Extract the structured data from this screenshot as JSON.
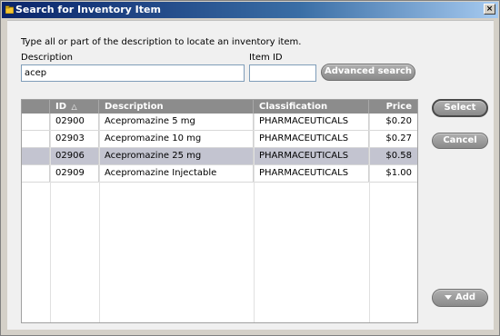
{
  "window": {
    "title": "Search for Inventory Item",
    "close_glyph": "×",
    "app_icon": "folder-icon"
  },
  "form": {
    "instructions": "Type all or part of the description to locate an inventory item.",
    "description_label": "Description",
    "description_value": "acep",
    "item_id_label": "Item ID",
    "item_id_value": "",
    "advanced_search_label": "Advanced search"
  },
  "table": {
    "columns": [
      {
        "label": ""
      },
      {
        "label": "ID",
        "sort": "ascending",
        "sort_glyph": "△"
      },
      {
        "label": "Description"
      },
      {
        "label": "Classification"
      },
      {
        "label": "Price"
      }
    ],
    "rows": [
      {
        "id": "02900",
        "description": "Acepromazine  5 mg",
        "classification": "PHARMACEUTICALS",
        "price": "$0.20",
        "selected": false
      },
      {
        "id": "02903",
        "description": "Acepromazine 10 mg",
        "classification": "PHARMACEUTICALS",
        "price": "$0.27",
        "selected": false
      },
      {
        "id": "02906",
        "description": "Acepromazine 25 mg",
        "classification": "PHARMACEUTICALS",
        "price": "$0.58",
        "selected": true
      },
      {
        "id": "02909",
        "description": "Acepromazine Injectable",
        "classification": "PHARMACEUTICALS",
        "price": "$1.00",
        "selected": false
      }
    ]
  },
  "actions": {
    "select_label": "Select",
    "cancel_label": "Cancel",
    "add_label": "Add"
  },
  "colors": {
    "titlebar": "#0a246a",
    "header": "#8c8c8c",
    "selected_row": "#c3c4d0",
    "button": "#8a8a8a"
  }
}
